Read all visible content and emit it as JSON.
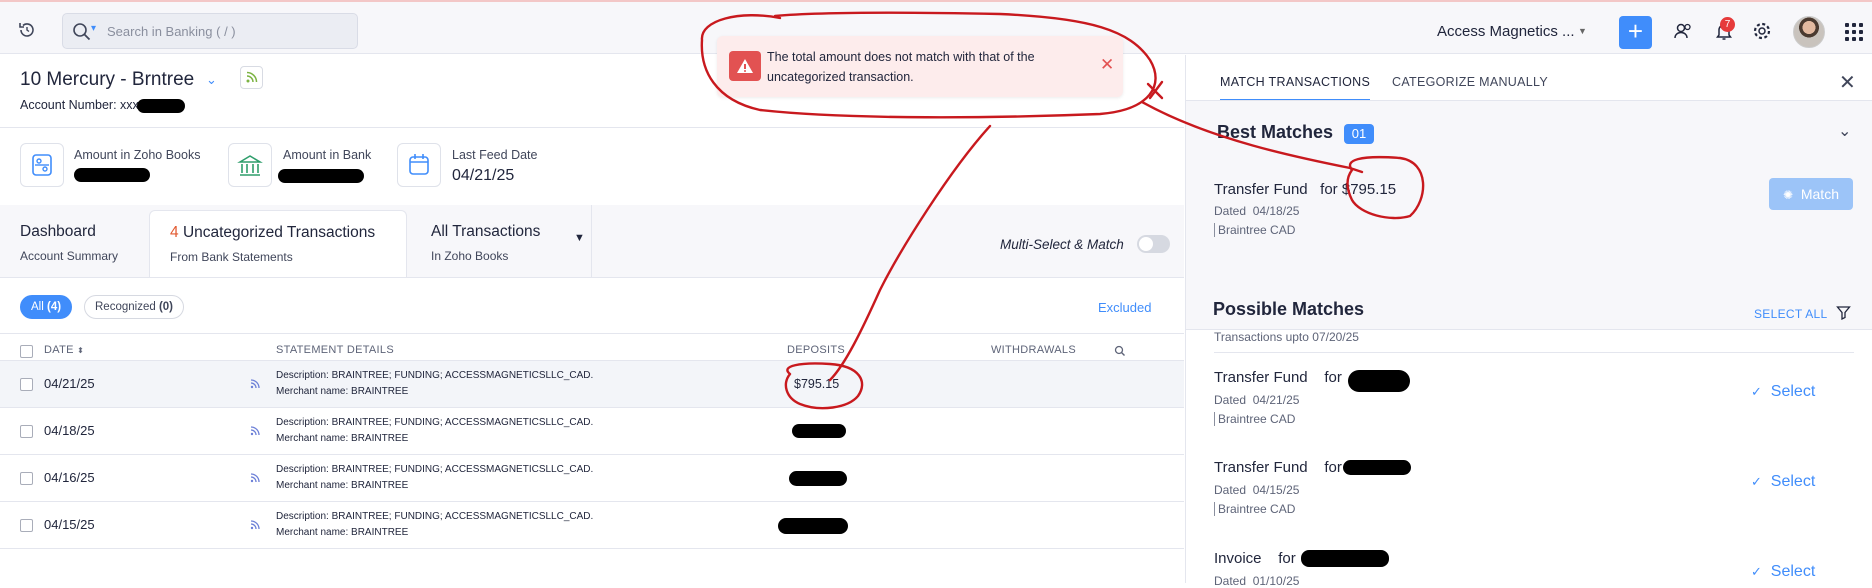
{
  "topbar": {
    "search_placeholder": "Search in Banking ( / )",
    "org_name": "Access Magnetics ...",
    "notification_count": "7"
  },
  "account": {
    "title": "10 Mercury - Brntree",
    "number_label": "Account Number: xxx"
  },
  "stats": [
    {
      "label": "Amount in Zoho Books",
      "value": ""
    },
    {
      "label": "Amount in Bank",
      "value": ""
    },
    {
      "label": "Last Feed Date",
      "value": "04/21/25"
    }
  ],
  "tabs": {
    "dashboard": {
      "title": "Dashboard",
      "sub": "Account Summary"
    },
    "uncategorized": {
      "count": "4",
      "title": "Uncategorized Transactions",
      "sub": "From Bank Statements"
    },
    "all": {
      "title": "All Transactions",
      "sub": "In Zoho Books"
    }
  },
  "multi_select_label": "Multi-Select & Match",
  "filters": {
    "all_label": "All",
    "all_count": "(4)",
    "recognized_label": "Recognized",
    "recognized_count": "(0)",
    "excluded_label": "Excluded"
  },
  "table": {
    "headers": {
      "date": "DATE",
      "details": "STATEMENT DETAILS",
      "deposits": "DEPOSITS",
      "withdrawals": "WITHDRAWALS"
    },
    "rows": [
      {
        "date": "04/21/25",
        "desc": "Description: BRAINTREE; FUNDING; ACCESSMAGNETICSLLC_CAD.",
        "merchant": "Merchant name: BRAINTREE",
        "deposit": "$795.15"
      },
      {
        "date": "04/18/25",
        "desc": "Description: BRAINTREE; FUNDING; ACCESSMAGNETICSLLC_CAD.",
        "merchant": "Merchant name: BRAINTREE",
        "deposit": ""
      },
      {
        "date": "04/16/25",
        "desc": "Description: BRAINTREE; FUNDING; ACCESSMAGNETICSLLC_CAD.",
        "merchant": "Merchant name: BRAINTREE",
        "deposit": ""
      },
      {
        "date": "04/15/25",
        "desc": "Description: BRAINTREE; FUNDING; ACCESSMAGNETICSLLC_CAD.",
        "merchant": "Merchant name: BRAINTREE",
        "deposit": ""
      }
    ]
  },
  "alert": {
    "message": "The total amount does not match with that of the uncategorized transaction."
  },
  "panel": {
    "tab_match": "MATCH TRANSACTIONS",
    "tab_categorize": "CATEGORIZE MANUALLY",
    "best_title": "Best Matches",
    "best_count": "01",
    "best": {
      "title": "Transfer Fund",
      "for": "for",
      "amount": "$795.15",
      "dated_label": "Dated",
      "date": "04/18/25",
      "source": "Braintree CAD",
      "button": "Match"
    },
    "possible_title": "Possible Matches",
    "possible_sub": "Transactions upto 07/20/25",
    "select_all": "SELECT ALL",
    "possible": [
      {
        "title": "Transfer Fund",
        "for": "for",
        "dated_label": "Dated",
        "date": "04/21/25",
        "source": "Braintree CAD",
        "button": "Select"
      },
      {
        "title": "Transfer Fund",
        "for": "for",
        "dated_label": "Dated",
        "date": "04/15/25",
        "source": "Braintree CAD",
        "button": "Select"
      },
      {
        "title": "Invoice",
        "for": "for",
        "dated_label": "Dated",
        "date": "01/10/25",
        "source": "",
        "button": "Select"
      }
    ]
  },
  "colors": {
    "accent": "#408dfb",
    "annotation": "#c8191e",
    "alert_bg": "#fdecec",
    "count_orange": "#e25a31"
  }
}
